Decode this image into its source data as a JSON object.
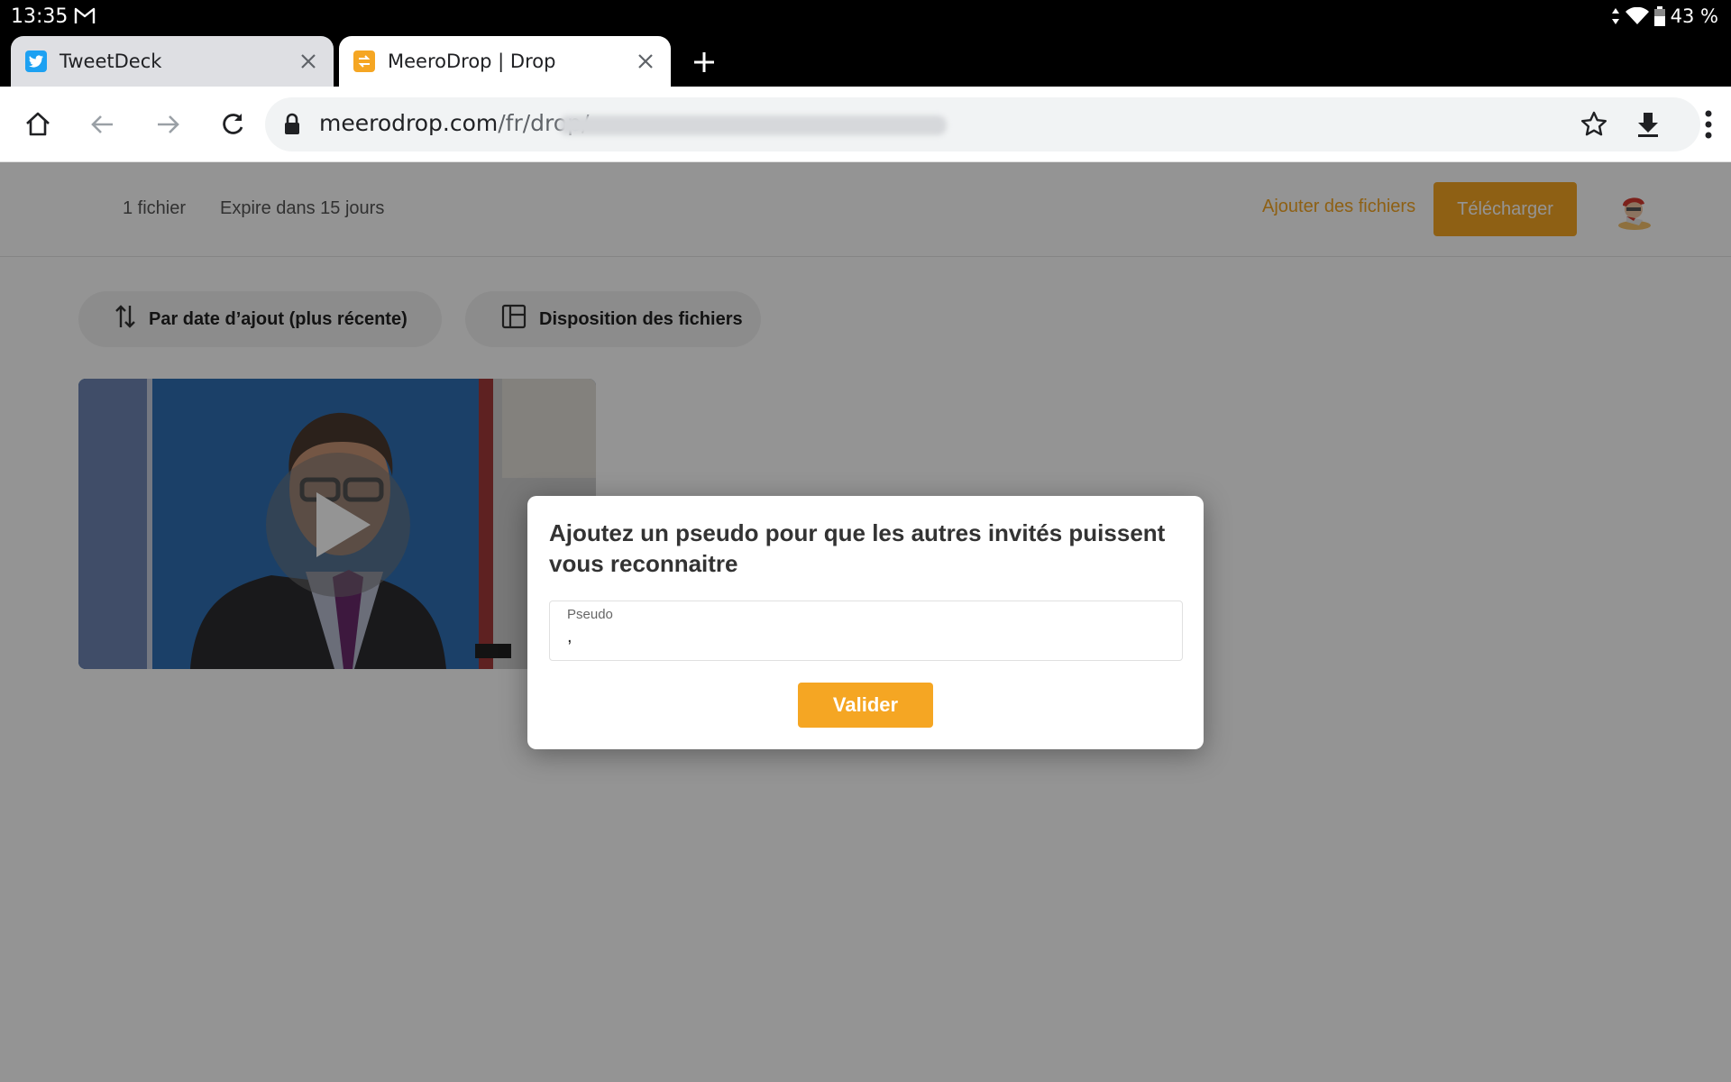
{
  "status_bar": {
    "time": "13:35",
    "battery": "43 %"
  },
  "tabs": [
    {
      "title": "TweetDeck",
      "active": false
    },
    {
      "title": "MeeroDrop | Drop",
      "active": true
    }
  ],
  "omnibox": {
    "domain": "meerodrop.com",
    "path": "/fr/drop/"
  },
  "page": {
    "file_count": "1 fichier",
    "expires": "Expire dans 15 jours",
    "add_files": "Ajouter des fichiers",
    "download": "Télécharger",
    "sort_label": "Par date d’ajout (plus récente)",
    "layout_label": "Disposition des fichiers"
  },
  "modal": {
    "title": "Ajoutez un pseudo pour que les autres invités puissent vous reconnaitre",
    "field_label": "Pseudo",
    "field_value": ",",
    "submit": "Valider"
  },
  "colors": {
    "accent": "#f5a623",
    "overlay": "rgba(0,0,0,0.42)",
    "twitter": "#1da1f2"
  }
}
